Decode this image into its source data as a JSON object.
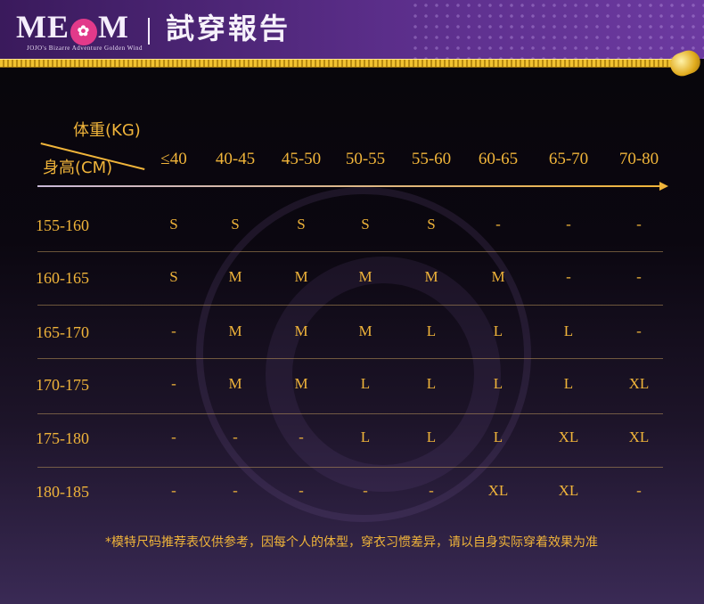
{
  "header": {
    "logo": [
      "ME",
      "M"
    ],
    "logo_subtitle": "JOJO's Bizarre Adventure Golden Wind",
    "title": "試穿報告"
  },
  "table": {
    "corner": {
      "weight": "体重(KG)",
      "height": "身高(CM)"
    },
    "columns": [
      "≤40",
      "40-45",
      "45-50",
      "50-55",
      "55-60",
      "60-65",
      "65-70",
      "70-80"
    ],
    "rows": [
      {
        "height": "155-160",
        "sizes": [
          "S",
          "S",
          "S",
          "S",
          "S",
          "-",
          "-",
          "-"
        ]
      },
      {
        "height": "160-165",
        "sizes": [
          "S",
          "M",
          "M",
          "M",
          "M",
          "M",
          "-",
          "-"
        ]
      },
      {
        "height": "165-170",
        "sizes": [
          "-",
          "M",
          "M",
          "M",
          "L",
          "L",
          "L",
          "-"
        ]
      },
      {
        "height": "170-175",
        "sizes": [
          "-",
          "M",
          "M",
          "L",
          "L",
          "L",
          "L",
          "XL"
        ]
      },
      {
        "height": "175-180",
        "sizes": [
          "-",
          "-",
          "-",
          "L",
          "L",
          "L",
          "XL",
          "XL"
        ]
      },
      {
        "height": "180-185",
        "sizes": [
          "-",
          "-",
          "-",
          "-",
          "-",
          "XL",
          "XL",
          "-"
        ]
      }
    ]
  },
  "note": "*模特尺码推荐表仅供参考，因每个人的体型，穿衣习惯差异，请以自身实际穿着效果为准",
  "colors": {
    "accent": "#f0b43a",
    "header_purple": "#5b2e8a",
    "zipper_gold": "#f1c231"
  }
}
